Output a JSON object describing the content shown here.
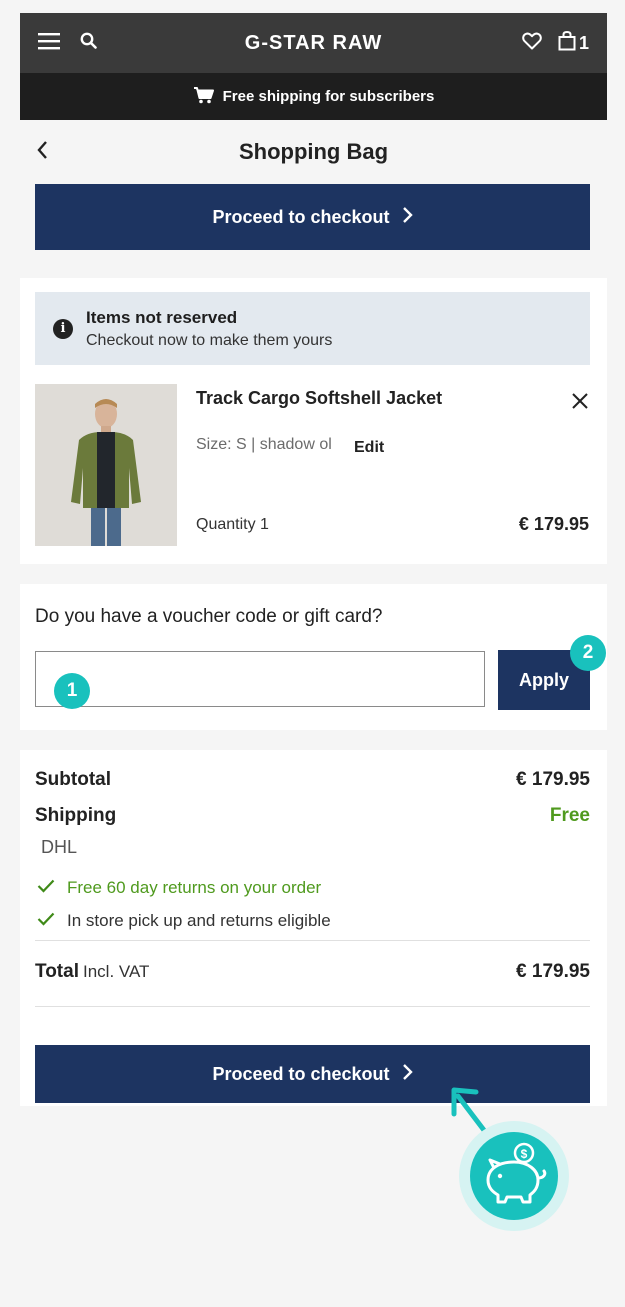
{
  "header": {
    "logo": "G-STAR RAW",
    "bag_count": "1",
    "promo": "Free shipping for subscribers"
  },
  "page_title": "Shopping Bag",
  "checkout_label": "Proceed to checkout",
  "notice": {
    "title": "Items not reserved",
    "text": "Checkout now to make them yours"
  },
  "product": {
    "name": "Track Cargo Softshell Jacket",
    "size": "Size: S | shadow ol",
    "edit": "Edit",
    "quantity": "Quantity 1",
    "price": "€ 179.95"
  },
  "voucher": {
    "question": "Do you have a voucher code or gift card?",
    "placeholder": "",
    "apply": "Apply",
    "marker1": "1",
    "marker2": "2"
  },
  "summary": {
    "subtotal_label": "Subtotal",
    "subtotal": "€ 179.95",
    "shipping_label": "Shipping",
    "shipping": "Free",
    "carrier": "DHL",
    "benefits": [
      "Free 60 day returns on your order",
      "In store pick up and returns eligible"
    ],
    "total_label": "Total",
    "incl_vat": "Incl. VAT",
    "total": "€ 179.95"
  },
  "colors": {
    "primary": "#1d3461",
    "accent": "#19c1bd",
    "success": "#4f9a1e"
  },
  "icons": [
    "menu-icon",
    "search-icon",
    "heart-icon",
    "bag-icon",
    "cart-icon",
    "chevron-left-icon",
    "chevron-right-icon",
    "info-icon",
    "close-icon",
    "check-icon",
    "piggy-bank-icon"
  ]
}
